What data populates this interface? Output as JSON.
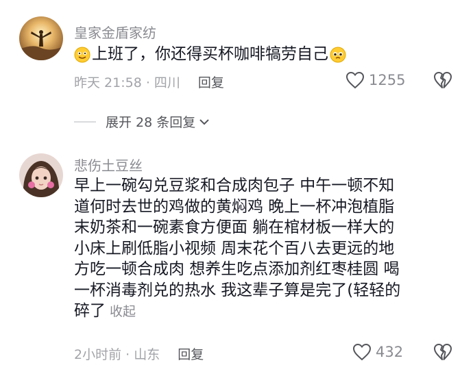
{
  "comments": [
    {
      "username": "皇家金盾家纺",
      "text": "上班了，你还得买杯咖啡犒劳自己",
      "time_location": "昨天 21:58 · 四川",
      "reply_label": "回复",
      "like_count": "1255"
    },
    {
      "username": "悲伤土豆丝",
      "text_lines": [
        "早上一碗勾兑豆浆和合成肉包子 中午一顿不知",
        "道何时去世的鸡做的黄焖鸡 晚上一杯冲泡植脂",
        "末奶茶和一碗素食方便面 躺在棺材板一样大的",
        "小床上刷低脂小视频 周末花个百八去更远的地",
        "方吃一顿合成肉 想养生吃点添加剂红枣桂圆 喝",
        "一杯消毒剂兑的热水 我这辈子算是完了(轻轻的",
        "碎了"
      ],
      "collapse_label": "收起",
      "time_location": "2小时前 · 山东",
      "reply_label": "回复",
      "like_count": "432"
    }
  ],
  "expand_replies_label": "展开 28 条回复"
}
